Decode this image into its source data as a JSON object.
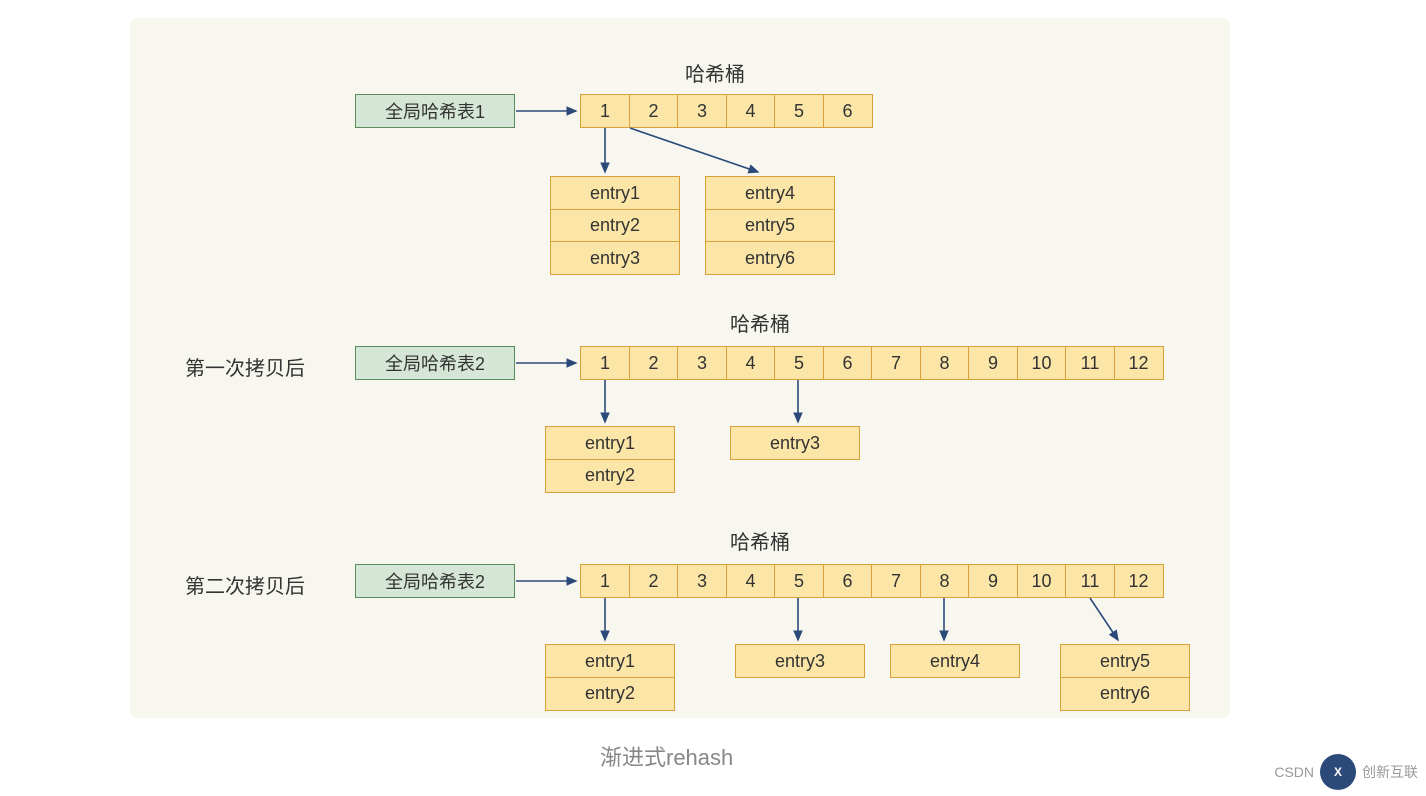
{
  "caption": "渐进式rehash",
  "watermark": {
    "left": "CSDN",
    "right": "创新互联"
  },
  "sections": [
    {
      "id": "s1",
      "stage_label": "",
      "table_label": "全局哈希表1",
      "bucket_title": "哈希桶",
      "buckets": [
        "1",
        "2",
        "3",
        "4",
        "5",
        "6"
      ],
      "chains": [
        {
          "from_bucket": 0,
          "entries": [
            "entry1",
            "entry2",
            "entry3"
          ]
        },
        {
          "from_bucket": 2,
          "entries": [
            "entry4",
            "entry5",
            "entry6"
          ]
        }
      ]
    },
    {
      "id": "s2",
      "stage_label": "第一次拷贝后",
      "table_label": "全局哈希表2",
      "bucket_title": "哈希桶",
      "buckets": [
        "1",
        "2",
        "3",
        "4",
        "5",
        "6",
        "7",
        "8",
        "9",
        "10",
        "11",
        "12"
      ],
      "chains": [
        {
          "from_bucket": 0,
          "entries": [
            "entry1",
            "entry2"
          ]
        },
        {
          "from_bucket": 4,
          "entries": [
            "entry3"
          ]
        }
      ]
    },
    {
      "id": "s3",
      "stage_label": "第二次拷贝后",
      "table_label": "全局哈希表2",
      "bucket_title": "哈希桶",
      "buckets": [
        "1",
        "2",
        "3",
        "4",
        "5",
        "6",
        "7",
        "8",
        "9",
        "10",
        "11",
        "12"
      ],
      "chains": [
        {
          "from_bucket": 0,
          "entries": [
            "entry1",
            "entry2"
          ]
        },
        {
          "from_bucket": 4,
          "entries": [
            "entry3"
          ]
        },
        {
          "from_bucket": 7,
          "entries": [
            "entry4"
          ]
        },
        {
          "from_bucket": 10,
          "entries": [
            "entry5",
            "entry6"
          ]
        }
      ]
    }
  ]
}
